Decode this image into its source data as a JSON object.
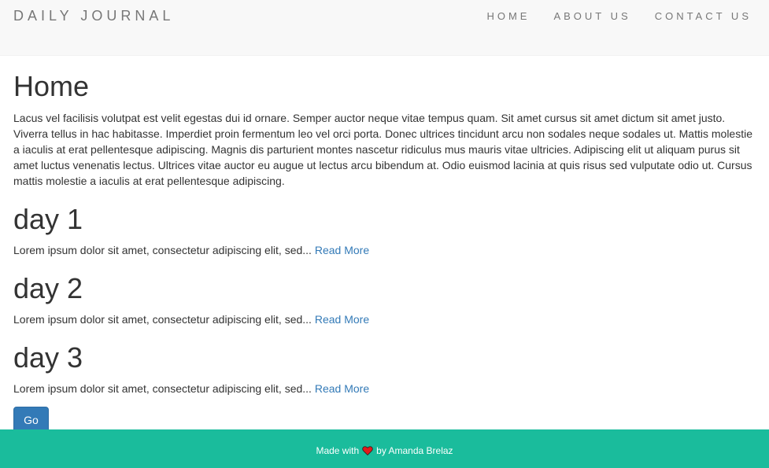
{
  "nav": {
    "brand": "DAILY JOURNAL",
    "links": [
      "HOME",
      "ABOUT US",
      "CONTACT US"
    ]
  },
  "main": {
    "title": "Home",
    "intro": "Lacus vel facilisis volutpat est velit egestas dui id ornare. Semper auctor neque vitae tempus quam. Sit amet cursus sit amet dictum sit amet justo. Viverra tellus in hac habitasse. Imperdiet proin fermentum leo vel orci porta. Donec ultrices tincidunt arcu non sodales neque sodales ut. Mattis molestie a iaculis at erat pellentesque adipiscing. Magnis dis parturient montes nascetur ridiculus mus mauris vitae ultricies. Adipiscing elit ut aliquam purus sit amet luctus venenatis lectus. Ultrices vitae auctor eu augue ut lectus arcu bibendum at. Odio euismod lacinia at quis risus sed vulputate odio ut. Cursus mattis molestie a iaculis at erat pellentesque adipiscing.",
    "posts": [
      {
        "title": "day 1",
        "excerpt": "Lorem ipsum dolor sit amet, consectetur adipiscing elit, sed... ",
        "link": "Read More"
      },
      {
        "title": "day 2",
        "excerpt": "Lorem ipsum dolor sit amet, consectetur adipiscing elit, sed... ",
        "link": "Read More"
      },
      {
        "title": "day 3",
        "excerpt": "Lorem ipsum dolor sit amet, consectetur adipiscing elit, sed... ",
        "link": "Read More"
      }
    ],
    "go_label": "Go"
  },
  "footer": {
    "prefix": "Made with",
    "icon": "heart-icon",
    "suffix": "by Amanda Brelaz",
    "heart_color": "#e21b1b"
  },
  "colors": {
    "navbar_bg": "#f8f8f8",
    "link": "#337ab7",
    "button": "#337ab7",
    "footer_bg": "#1abc9c"
  }
}
